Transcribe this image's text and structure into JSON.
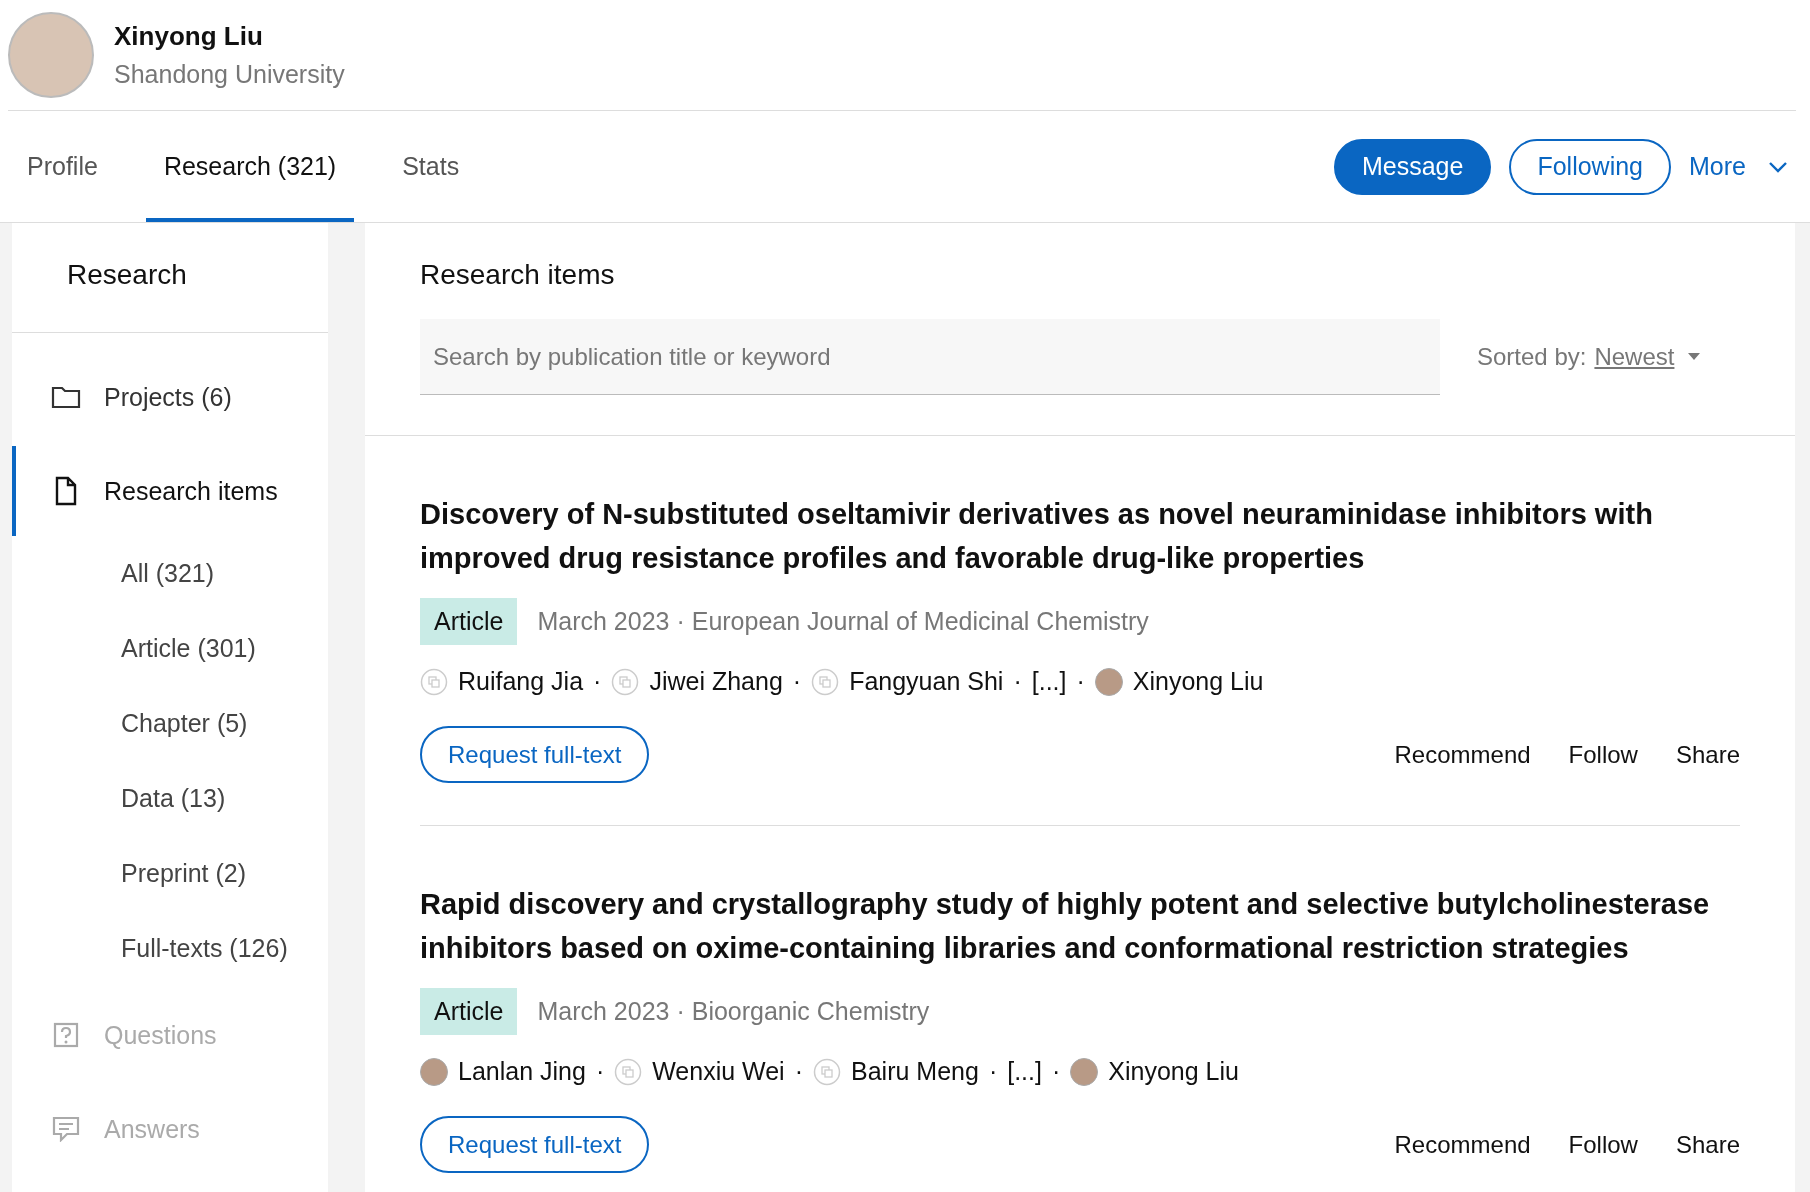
{
  "profile": {
    "name": "Xinyong Liu",
    "institution": "Shandong University"
  },
  "tabs": [
    {
      "label": "Profile",
      "selected": false
    },
    {
      "label": "Research (321)",
      "selected": true
    },
    {
      "label": "Stats",
      "selected": false
    }
  ],
  "actions": [
    {
      "label": "Message",
      "kind": "primary"
    },
    {
      "label": "Following",
      "kind": "outline"
    },
    {
      "label": "More",
      "kind": "menu"
    }
  ],
  "sidebar": {
    "title": "Research",
    "items": [
      {
        "label": "Projects (6)",
        "kind": "folder",
        "selected": false,
        "disabled": false
      },
      {
        "label": "Research items",
        "kind": "document",
        "selected": true,
        "disabled": false,
        "children": [
          {
            "label": "All (321)",
            "selected": false
          },
          {
            "label": "Article (301)",
            "selected": false
          },
          {
            "label": "Chapter (5)",
            "selected": false
          },
          {
            "label": "Data (13)",
            "selected": false
          },
          {
            "label": "Preprint (2)",
            "selected": false
          },
          {
            "label": "Full-texts (126)",
            "selected": false
          }
        ]
      },
      {
        "label": "Questions",
        "kind": "question",
        "selected": false,
        "disabled": true
      },
      {
        "label": "Answers",
        "kind": "answer",
        "selected": false,
        "disabled": true
      }
    ]
  },
  "main": {
    "title": "Research items",
    "search": {
      "placeholder": "Search by publication title or keyword"
    },
    "sort": {
      "label": "Sorted by:",
      "value": "Newest"
    },
    "items": [
      {
        "title": "Discovery of N-substituted oseltamivir derivatives as novel neuraminidase inhibitors with improved drug resistance profiles and favorable drug-like properties",
        "type": "Article",
        "meta": "March 2023 · European Journal of Medicinal Chemistry",
        "authors": [
          {
            "name": "Ruifang Jia",
            "kind": "placeholder"
          },
          {
            "name": "·",
            "kind": "separator"
          },
          {
            "name": "Jiwei Zhang",
            "kind": "placeholder"
          },
          {
            "name": "·",
            "kind": "separator"
          },
          {
            "name": "Fangyuan Shi",
            "kind": "placeholder"
          },
          {
            "name": "·",
            "kind": "separator"
          },
          {
            "name": "[...]",
            "kind": "more"
          },
          {
            "name": "·",
            "kind": "separator"
          },
          {
            "name": "Xinyong Liu",
            "kind": "photo"
          }
        ],
        "request": "Request full-text",
        "links": [
          "Recommend",
          "Follow",
          "Share"
        ]
      },
      {
        "title": "Rapid discovery and crystallography study of highly potent and selective butylcholinesterase inhibitors based on oxime-containing libraries and conformational restriction strategies",
        "type": "Article",
        "meta": "March 2023 · Bioorganic Chemistry",
        "authors": [
          {
            "name": "Lanlan Jing",
            "kind": "photo"
          },
          {
            "name": "·",
            "kind": "separator"
          },
          {
            "name": "Wenxiu Wei",
            "kind": "placeholder"
          },
          {
            "name": "·",
            "kind": "separator"
          },
          {
            "name": "Bairu Meng",
            "kind": "placeholder"
          },
          {
            "name": "·",
            "kind": "separator"
          },
          {
            "name": "[...]",
            "kind": "more"
          },
          {
            "name": "·",
            "kind": "separator"
          },
          {
            "name": "Xinyong Liu",
            "kind": "photo"
          }
        ],
        "request": "Request full-text",
        "links": [
          "Recommend",
          "Follow",
          "Share"
        ]
      }
    ]
  }
}
